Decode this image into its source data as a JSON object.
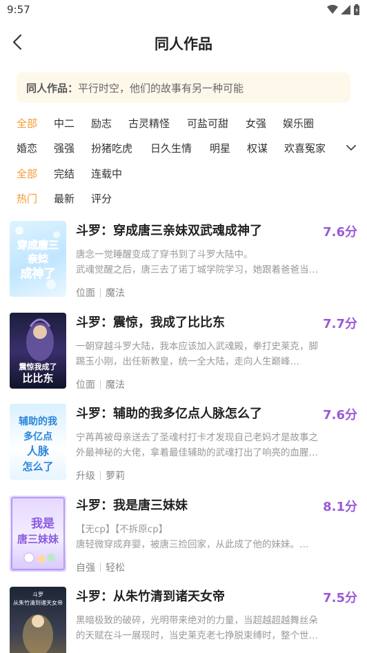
{
  "status": {
    "time": "9:57"
  },
  "header": {
    "title": "同人作品"
  },
  "banner": {
    "label": "同人作品：",
    "text": "平行时空，他们的故事有另一种可能"
  },
  "filters": {
    "row1": [
      "全部",
      "中二",
      "励志",
      "古灵精怪",
      "可盐可甜",
      "女强",
      "娱乐圈"
    ],
    "row2": [
      "婚恋",
      "强强",
      "扮猪吃虎",
      "日久生情",
      "明星",
      "权谋",
      "欢喜冤家"
    ],
    "row3": [
      "全部",
      "完结",
      "连载中"
    ],
    "row4": [
      "热门",
      "最新",
      "评分"
    ]
  },
  "colors": {
    "accent": "#f29a32",
    "score": "#9b59d8",
    "banner_bg": "#fdf8ea"
  },
  "books": [
    {
      "title": "斗罗：穿成唐三亲妹双武魂成神了",
      "score": "7.6分",
      "desc1": "唐念一觉睡醒变成了穿书到了斗罗大陆中。",
      "desc2": "武魂觉醒之后，唐三去了诺丁城学院学习，她跟着爸爸当…",
      "tag1": "位面",
      "tag2": "魔法",
      "cover_text": "穿成唐三亲妹成神了"
    },
    {
      "title": "斗罗：震惊，我成了比比东",
      "score": "7.7分",
      "desc1": "一朝穿越斗罗大陆，我本应该加入武魂殿，拳打史莱克，脚",
      "desc2": "踢玉小刚，出任新教皇，统一全大陆，走向人生巅峰…",
      "tag1": "位面",
      "tag2": "魔法",
      "cover_text": "震惊我成了比比东"
    },
    {
      "title": "斗罗：辅助的我多亿点人脉怎么了",
      "score": "7.6分",
      "desc1": "宁苒苒被母亲送去了圣魂村打卡才发现自己老妈才是故事之",
      "desc2": "外最神秘的大佬，拿着最佳辅助的武魂打出了响亮的血腥…",
      "tag1": "升级",
      "tag2": "萝莉",
      "cover_text": "辅助的我多亿点人脉怎么了"
    },
    {
      "title": "斗罗：我是唐三妹妹",
      "score": "8.1分",
      "desc1": "【无cp】【不拆原cp】",
      "desc2": "唐轻微穿成弃婴，被唐三捡回家，从此成了他的妹妹。…",
      "tag1": "自强",
      "tag2": "轻松",
      "cover_text": "我是唐三妹妹"
    },
    {
      "title": "斗罗：从朱竹清到诸天女帝",
      "score": "7.5分",
      "desc1": "黑暗极致的破碎，光明带来绝对的力量，当超越超越舞丝朵",
      "desc2": "的天赋在斗一展现时，当史莱克老七挣脱束缚时，整个世…",
      "tag1": "",
      "tag2": "",
      "cover_text": "从朱竹清到诸天女帝"
    }
  ]
}
